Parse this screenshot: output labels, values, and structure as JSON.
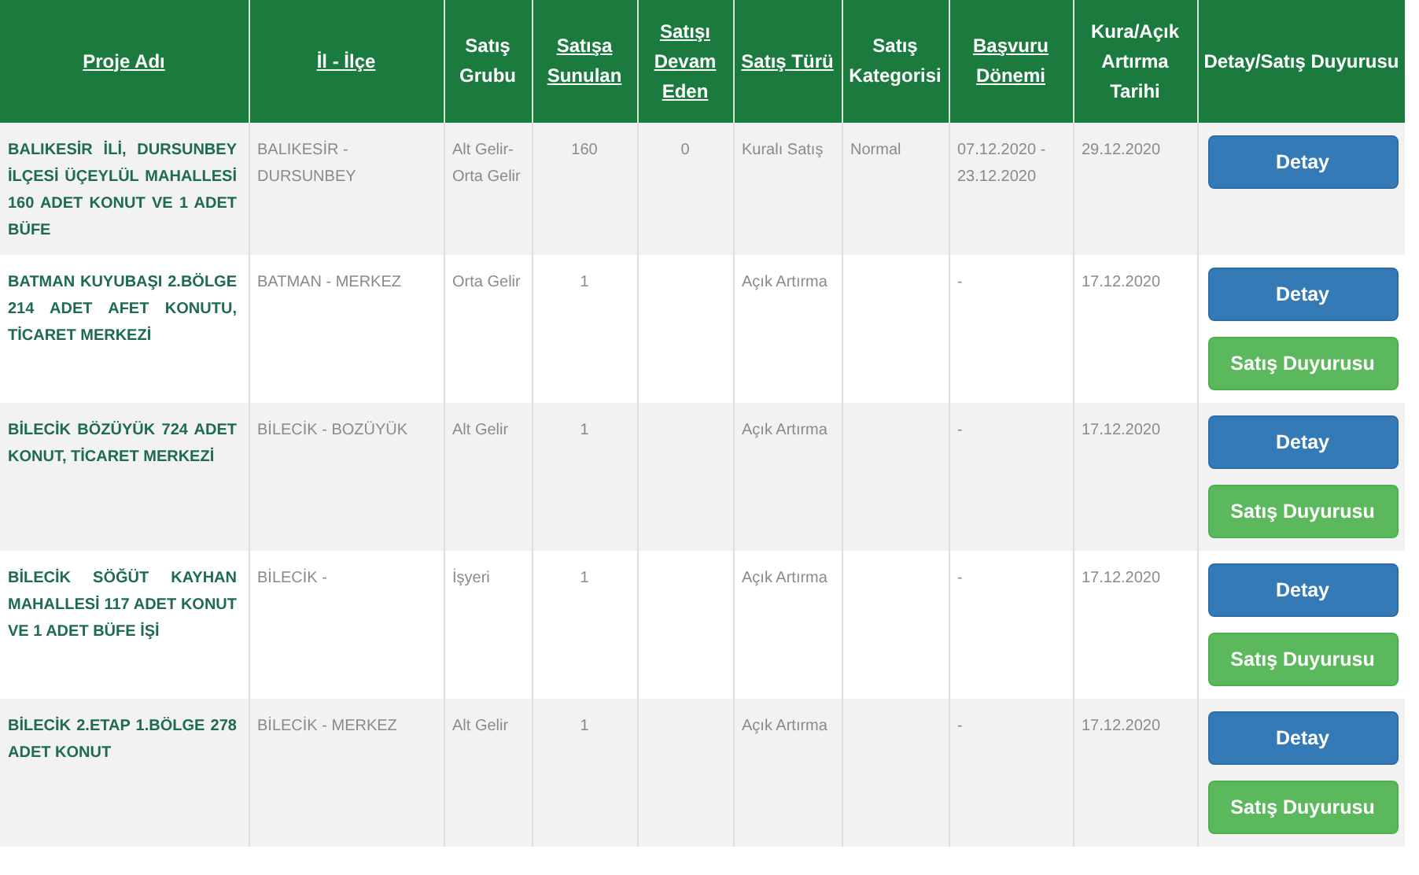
{
  "table": {
    "columns": [
      {
        "label": "Proje Adı",
        "sortable": true
      },
      {
        "label": "İl - İlçe",
        "sortable": true
      },
      {
        "label": "Satış Grubu",
        "sortable": false
      },
      {
        "label": "Satışa Sunulan",
        "sortable": true
      },
      {
        "label": "Satışı Devam Eden",
        "sortable": true
      },
      {
        "label": "Satış Türü",
        "sortable": true
      },
      {
        "label": "Satış Kategorisi",
        "sortable": false
      },
      {
        "label": "Başvuru Dönemi",
        "sortable": true
      },
      {
        "label": "Kura/Açık Artırma Tarihi",
        "sortable": false
      },
      {
        "label": "Detay/Satış Duyurusu",
        "sortable": false
      }
    ],
    "rows": [
      {
        "project": "BALIKESİR İLİ, DURSUNBEY İLÇESİ ÜÇEYLÜL MAHALLESİ 160 ADET KONUT VE 1 ADET BÜFE",
        "location": "BALIKESİR - DURSUNBEY",
        "group": "Alt Gelir-Orta Gelir",
        "offered": "160",
        "ongoing": "0",
        "sale_type": "Kuralı Satış",
        "category": "Normal",
        "period": "07.12.2020 - 23.12.2020",
        "date": "29.12.2020",
        "buttons": [
          {
            "kind": "detail",
            "label": "Detay"
          }
        ]
      },
      {
        "project": "BATMAN KUYUBAŞI 2.BÖLGE 214 ADET AFET KONUTU, TİCARET MERKEZİ",
        "location": "BATMAN - MERKEZ",
        "group": "Orta Gelir",
        "offered": "1",
        "sale_type": "Açık Artırma",
        "period": "-",
        "date": "17.12.2020",
        "buttons": [
          {
            "kind": "detail",
            "label": "Detay"
          },
          {
            "kind": "announcement",
            "label": "Satış Duyurusu"
          }
        ]
      },
      {
        "project": "BİLECİK BÖZÜYÜK 724 ADET KONUT, TİCARET MERKEZİ",
        "location": "BİLECİK - BOZÜYÜK",
        "group": "Alt Gelir",
        "offered": "1",
        "sale_type": "Açık Artırma",
        "period": "-",
        "date": "17.12.2020",
        "buttons": [
          {
            "kind": "detail",
            "label": "Detay"
          },
          {
            "kind": "announcement",
            "label": "Satış Duyurusu"
          }
        ]
      },
      {
        "project": "BİLECİK SÖĞÜT KAYHAN MAHALLESİ 117 ADET KONUT VE 1 ADET BÜFE İŞİ",
        "location": "BİLECİK -",
        "group": "İşyeri",
        "offered": "1",
        "sale_type": "Açık Artırma",
        "period": "-",
        "date": "17.12.2020",
        "buttons": [
          {
            "kind": "detail",
            "label": "Detay"
          },
          {
            "kind": "announcement",
            "label": "Satış Duyurusu"
          }
        ]
      },
      {
        "project": "BİLECİK 2.ETAP 1.BÖLGE 278 ADET KONUT",
        "location": "BİLECİK - MERKEZ",
        "group": "Alt Gelir",
        "offered": "1",
        "sale_type": "Açık Artırma",
        "period": "-",
        "date": "17.12.2020",
        "buttons": [
          {
            "kind": "detail",
            "label": "Detay"
          },
          {
            "kind": "announcement",
            "label": "Satış Duyurusu"
          }
        ]
      }
    ]
  }
}
